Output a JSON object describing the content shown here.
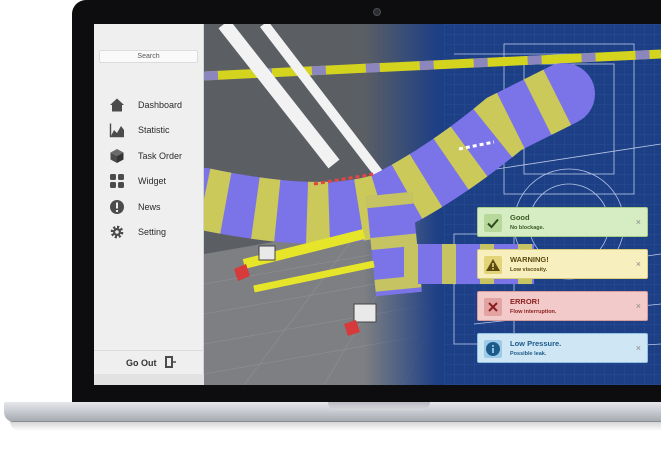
{
  "sidebar": {
    "search": {
      "placeholder": "Search"
    },
    "items": [
      {
        "label": "Dashboard",
        "icon": "home-icon"
      },
      {
        "label": "Statistic",
        "icon": "chart-icon"
      },
      {
        "label": "Task Order",
        "icon": "box-icon"
      },
      {
        "label": "Widget",
        "icon": "grid-icon"
      },
      {
        "label": "News",
        "icon": "alert-circle-icon"
      },
      {
        "label": "Setting",
        "icon": "gear-icon"
      }
    ],
    "go_out": {
      "label": "Go Out",
      "icon": "exit-door-icon"
    }
  },
  "notifications": [
    {
      "type": "success",
      "title": "Good",
      "message": "No blockage.",
      "icon": "check-icon",
      "close": "×",
      "color": "#d6ecc3"
    },
    {
      "type": "warning",
      "title": "WARNING!",
      "message": "Low viscosity.",
      "icon": "warning-icon",
      "close": "×",
      "color": "#f7efbd"
    },
    {
      "type": "error",
      "title": "ERROR!",
      "message": "Flow interruption.",
      "icon": "error-icon",
      "close": "×",
      "color": "#f3caca"
    },
    {
      "type": "info",
      "title": "Low Pressure.",
      "message": "Possible leak.",
      "icon": "info-icon",
      "close": "×",
      "color": "#cfe6f5"
    }
  ],
  "colors": {
    "blueprint": "#1d3f86",
    "pipe_purple": "#7b73e8",
    "pipe_yellow": "#e6e52a"
  }
}
